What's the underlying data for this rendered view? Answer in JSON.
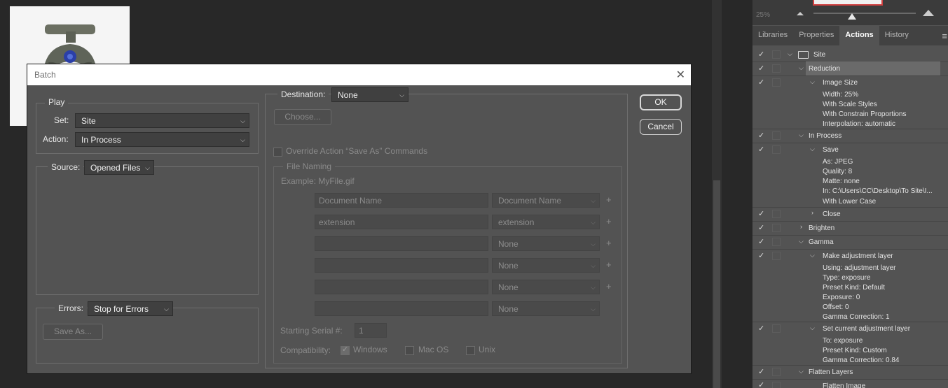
{
  "panel": {
    "zoom": "25%",
    "tabs": [
      {
        "label": "Libraries"
      },
      {
        "label": "Properties"
      },
      {
        "label": "Actions"
      },
      {
        "label": "History"
      }
    ],
    "actions": {
      "set_name": "Site",
      "reduction": "Reduction",
      "image_size": "Image Size",
      "image_size_details": [
        "Width: 25%",
        "With Scale Styles",
        "With Constrain Proportions",
        "Interpolation: automatic"
      ],
      "in_process": "In Process",
      "save": "Save",
      "save_details": [
        "As: JPEG",
        "Quality: 8",
        "Matte: none",
        "In: C:\\Users\\CC\\Desktop\\To Site\\I...",
        "With Lower Case"
      ],
      "close": "Close",
      "brighten": "Brighten",
      "gamma": "Gamma",
      "make_adj": "Make adjustment layer",
      "make_adj_details": [
        "Using: adjustment layer",
        "Type: exposure",
        "Preset Kind: Default",
        "Exposure: 0",
        "Offset: 0",
        "Gamma Correction: 1"
      ],
      "set_adj": "Set current adjustment layer",
      "set_adj_details": [
        "To: exposure",
        "Preset Kind: Custom",
        "Gamma Correction: 0.84"
      ],
      "flatten_layers": "Flatten Layers",
      "flatten_image": "Flatten Image"
    }
  },
  "dialog": {
    "title": "Batch",
    "ok": "OK",
    "cancel": "Cancel",
    "play": {
      "legend": "Play",
      "set_label": "Set:",
      "set_value": "Site",
      "action_label": "Action:",
      "action_value": "In Process"
    },
    "source": {
      "label": "Source:",
      "value": "Opened Files"
    },
    "errors": {
      "label": "Errors:",
      "value": "Stop for Errors",
      "save_as": "Save As..."
    },
    "destination": {
      "label": "Destination:",
      "value": "None",
      "choose": "Choose...",
      "override": "Override Action “Save As” Commands"
    },
    "naming": {
      "legend": "File Naming",
      "example": "Example: MyFile.gif",
      "rows": [
        {
          "field": "Document Name",
          "select": "Document Name",
          "plus": "+"
        },
        {
          "field": "extension",
          "select": "extension",
          "plus": "+"
        },
        {
          "field": "",
          "select": "None",
          "plus": "+"
        },
        {
          "field": "",
          "select": "None",
          "plus": "+"
        },
        {
          "field": "",
          "select": "None",
          "plus": "+"
        },
        {
          "field": "",
          "select": "None",
          "plus": ""
        }
      ],
      "serial_label": "Starting Serial #:",
      "serial_value": "1",
      "compat_label": "Compatibility:",
      "windows": "Windows",
      "macos": "Mac OS",
      "unix": "Unix"
    }
  }
}
